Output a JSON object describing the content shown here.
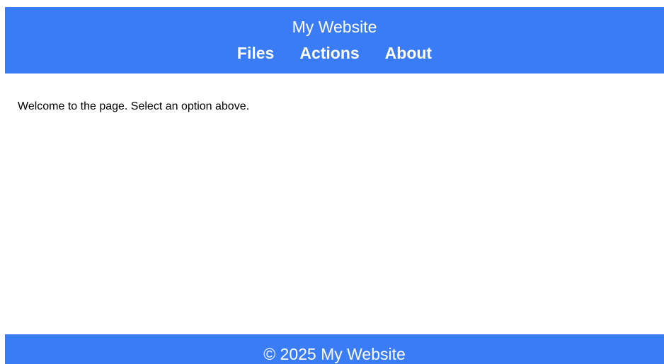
{
  "header": {
    "title": "My Website",
    "nav": [
      "Files",
      "Actions",
      "About"
    ]
  },
  "main": {
    "message": "Welcome to the page. Select an option above."
  },
  "footer": {
    "text": "© 2025 My Website"
  },
  "colors": {
    "accent": "#3a7cf5",
    "text_on_accent": "#ffffff"
  }
}
